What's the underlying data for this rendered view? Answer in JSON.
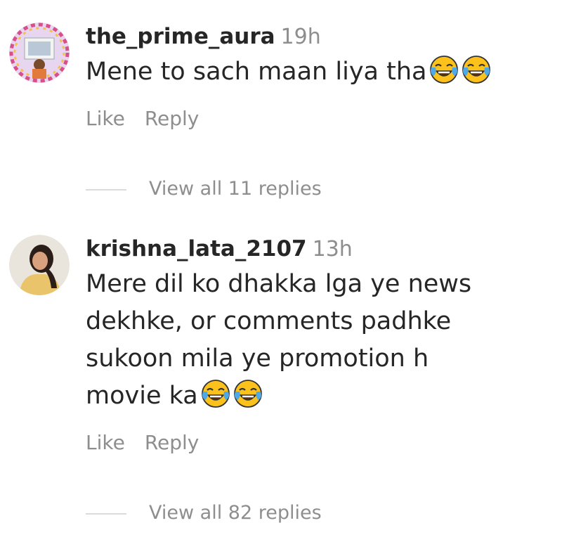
{
  "comments": [
    {
      "username": "the_prime_aura",
      "time": "19h",
      "text": "Mene to sach maan liya tha",
      "emojis": [
        "face-with-tears-of-joy",
        "face-with-tears-of-joy"
      ],
      "like_label": "Like",
      "reply_label": "Reply",
      "view_replies": "View all 11 replies"
    },
    {
      "username": "krishna_lata_2107",
      "time": "13h",
      "text_lines": [
        "Mere dil ko dhakka lga ye news",
        "dekhke, or comments padhke",
        "sukoon mila ye promotion h",
        "movie ka"
      ],
      "emojis": [
        "face-with-tears-of-joy",
        "face-with-tears-of-joy"
      ],
      "like_label": "Like",
      "reply_label": "Reply",
      "view_replies": "View all 82 replies"
    }
  ],
  "colors": {
    "primary_text": "#262626",
    "secondary_text": "#8e8e8e",
    "divider": "#dbdbdb",
    "emoji_face": "#fcc21b",
    "emoji_tears": "#4fa9e6"
  }
}
